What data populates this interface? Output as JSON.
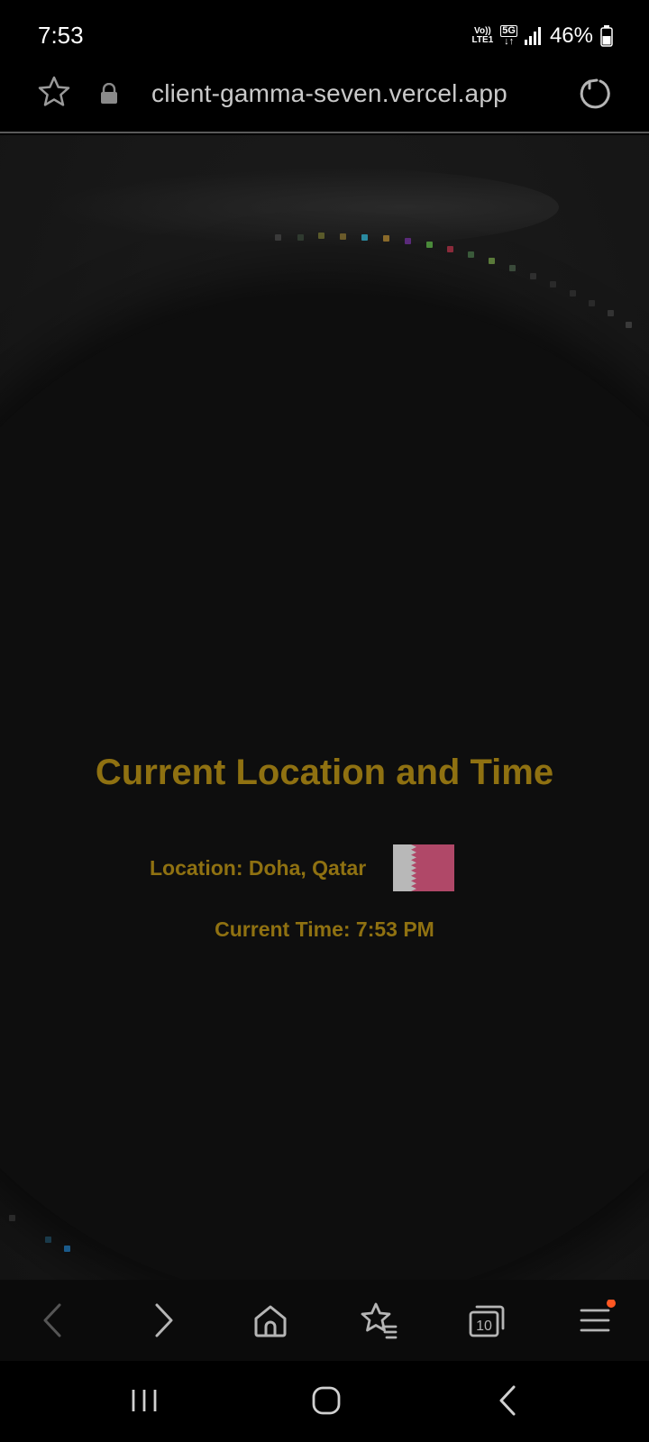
{
  "status_bar": {
    "time": "7:53",
    "volte_top": "Vo))",
    "volte_bottom": "LTE1",
    "network": "5G",
    "battery": "46%"
  },
  "browser": {
    "url": "client-gamma-seven.vercel.app",
    "tab_count": "10",
    "notification_dot_color": "#ff5722"
  },
  "page": {
    "title": "Current Location and Time",
    "location": "Location: Doha, Qatar",
    "current_time": "Current Time: 7:53 PM",
    "accent_color": "#8f7111"
  },
  "flag": {
    "country": "Qatar",
    "white": "#b8b8b8",
    "maroon": "#b04868"
  }
}
